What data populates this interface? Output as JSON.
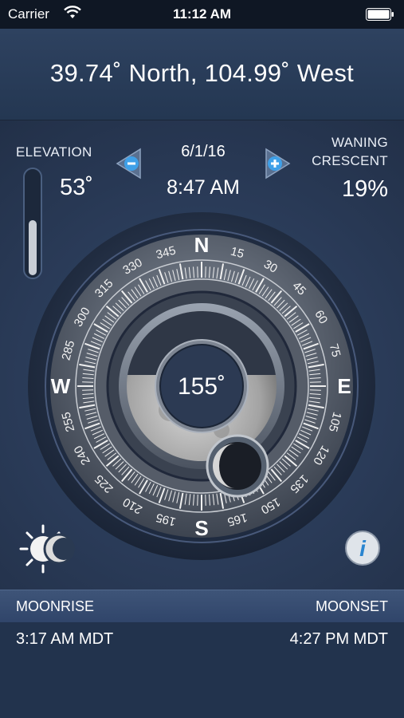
{
  "status_bar": {
    "carrier": "Carrier",
    "time": "11:12 AM"
  },
  "location": {
    "coordinates": "39.74˚ North, 104.99˚ West"
  },
  "elevation": {
    "label": "ELEVATION",
    "value": "53˚",
    "level": 0.53
  },
  "date_time": {
    "date": "6/1/16",
    "time": "8:47 AM"
  },
  "moon_phase": {
    "line1": "WANING",
    "line2": "CRESCENT",
    "illumination": "19%"
  },
  "compass": {
    "azimuth": "155˚",
    "azimuth_degrees": 155,
    "cardinals": {
      "n": "N",
      "e": "E",
      "s": "S",
      "w": "W"
    },
    "tick_labels": [
      "15",
      "30",
      "45",
      "60",
      "75",
      "105",
      "120",
      "135",
      "150",
      "165",
      "195",
      "210",
      "225",
      "240",
      "255",
      "285",
      "300",
      "315",
      "330",
      "345"
    ]
  },
  "footer": {
    "moonrise_label": "MOONRISE",
    "moonset_label": "MOONSET",
    "moonrise_time": "3:17 AM MDT",
    "moonset_time": "4:27 PM MDT"
  },
  "colors": {
    "accent_blue": "#3fa0e8",
    "background": "#2a3a52",
    "status_bar": "#0f1724"
  },
  "icons": [
    "wifi-icon",
    "battery-icon",
    "minus-button-icon",
    "plus-button-icon",
    "sun-moon-toggle-icon",
    "info-icon"
  ]
}
